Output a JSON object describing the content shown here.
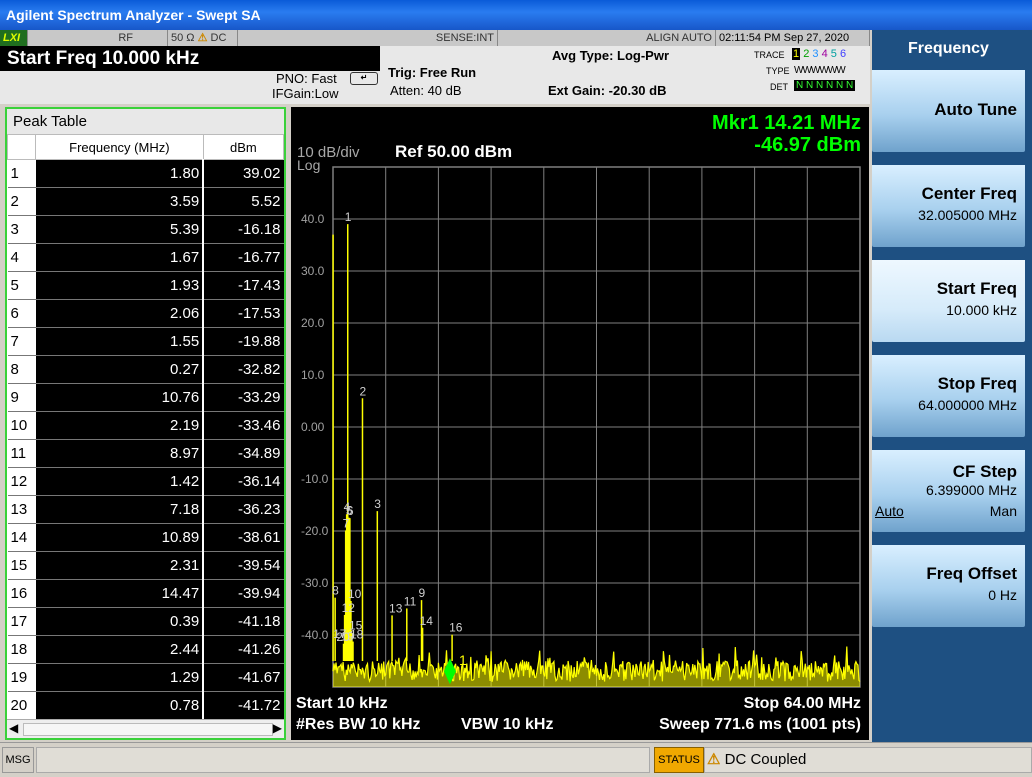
{
  "window": {
    "title": "Agilent Spectrum Analyzer - Swept SA"
  },
  "status_row": {
    "lxi": "LXI",
    "rf": "RF",
    "impedance": "50 Ω",
    "coupling": "DC",
    "sense": "SENSE:INT",
    "align": "ALIGN AUTO",
    "datetime": "02:11:54 PM Sep 27, 2020"
  },
  "info": {
    "active_param": "Start Freq 10.000 kHz",
    "pno": "PNO: Fast",
    "ifgain": "IFGain:Low",
    "trig": "Trig: Free Run",
    "atten": "Atten: 40 dB",
    "avg_type": "Avg Type: Log-Pwr",
    "ext_gain": "Ext Gain: -20.30 dB",
    "trace_label": "TRACE",
    "trace_nums": [
      "1",
      "2",
      "3",
      "4",
      "5",
      "6"
    ],
    "type_label": "TYPE",
    "type_value": "WWWWWW",
    "det_label": "DET",
    "det_value": "N N N N N N"
  },
  "peak_table": {
    "title": "Peak Table",
    "col_freq": "Frequency (MHz)",
    "col_dbm": "dBm",
    "rows": [
      {
        "n": "1",
        "f": "1.80",
        "d": "39.02"
      },
      {
        "n": "2",
        "f": "3.59",
        "d": "5.52"
      },
      {
        "n": "3",
        "f": "5.39",
        "d": "-16.18"
      },
      {
        "n": "4",
        "f": "1.67",
        "d": "-16.77"
      },
      {
        "n": "5",
        "f": "1.93",
        "d": "-17.43"
      },
      {
        "n": "6",
        "f": "2.06",
        "d": "-17.53"
      },
      {
        "n": "7",
        "f": "1.55",
        "d": "-19.88"
      },
      {
        "n": "8",
        "f": "0.27",
        "d": "-32.82"
      },
      {
        "n": "9",
        "f": "10.76",
        "d": "-33.29"
      },
      {
        "n": "10",
        "f": "2.19",
        "d": "-33.46"
      },
      {
        "n": "11",
        "f": "8.97",
        "d": "-34.89"
      },
      {
        "n": "12",
        "f": "1.42",
        "d": "-36.14"
      },
      {
        "n": "13",
        "f": "7.18",
        "d": "-36.23"
      },
      {
        "n": "14",
        "f": "10.89",
        "d": "-38.61"
      },
      {
        "n": "15",
        "f": "2.31",
        "d": "-39.54"
      },
      {
        "n": "16",
        "f": "14.47",
        "d": "-39.94"
      },
      {
        "n": "17",
        "f": "0.39",
        "d": "-41.18"
      },
      {
        "n": "18",
        "f": "2.44",
        "d": "-41.26"
      },
      {
        "n": "19",
        "f": "1.29",
        "d": "-41.67"
      },
      {
        "n": "20",
        "f": "0.78",
        "d": "-41.72"
      }
    ]
  },
  "plot": {
    "scale": "10 dB/div",
    "log": "Log",
    "ref": "Ref 50.00 dBm",
    "marker_freq": "Mkr1 14.21 MHz",
    "marker_amp": "-46.97 dBm",
    "marker_label": "1",
    "start": "Start 10 kHz",
    "stop": "Stop 64.00 MHz",
    "res_bw": "#Res BW 10 kHz",
    "vbw": "VBW 10 kHz",
    "sweep": "Sweep  771.6 ms (1001 pts)",
    "y_ticks": [
      "40.0",
      "30.0",
      "20.0",
      "10.0",
      "0.00",
      "-10.0",
      "-20.0",
      "-30.0",
      "-40.0"
    ]
  },
  "chart_data": {
    "type": "line",
    "xlabel": "",
    "ylabel": "",
    "xlim": [
      0.01,
      64.0
    ],
    "ylim": [
      -50,
      50
    ],
    "y_ticks": [
      40,
      30,
      20,
      10,
      0,
      -10,
      -20,
      -30,
      -40
    ],
    "series": [
      {
        "values": [
          [
            0.27,
            -32.82
          ],
          [
            1.29,
            -41.67
          ],
          [
            1.42,
            -36.14
          ],
          [
            1.55,
            -19.88
          ],
          [
            1.67,
            -16.77
          ],
          [
            1.8,
            39.02
          ],
          [
            1.93,
            -17.43
          ],
          [
            2.06,
            -17.53
          ],
          [
            2.19,
            -33.46
          ],
          [
            2.31,
            -39.54
          ],
          [
            2.44,
            -41.26
          ],
          [
            3.59,
            5.52
          ],
          [
            5.39,
            -16.18
          ],
          [
            7.18,
            -36.23
          ],
          [
            8.97,
            -34.89
          ],
          [
            10.76,
            -33.29
          ],
          [
            10.89,
            -38.61
          ],
          [
            14.47,
            -39.94
          ]
        ]
      }
    ],
    "marker": {
      "x": 14.21,
      "y": -46.97
    },
    "noise_floor": -45,
    "grid": true
  },
  "softkeys": {
    "menu": "Frequency",
    "auto_tune": "Auto Tune",
    "center_label": "Center Freq",
    "center_value": "32.005000 MHz",
    "start_label": "Start Freq",
    "start_value": "10.000 kHz",
    "stop_label": "Stop Freq",
    "stop_value": "64.000000 MHz",
    "cfstep_label": "CF Step",
    "cfstep_value": "6.399000 MHz",
    "cfstep_auto": "Auto",
    "cfstep_man": "Man",
    "offset_label": "Freq Offset",
    "offset_value": "0 Hz"
  },
  "bottom": {
    "msg": "MSG",
    "status": "STATUS",
    "dc_coupled": "DC Coupled"
  },
  "colors": {
    "trace": "#ffff00",
    "marker": "#00ff00",
    "grid": "#7f7f7f",
    "accent": "#3ad13a"
  }
}
